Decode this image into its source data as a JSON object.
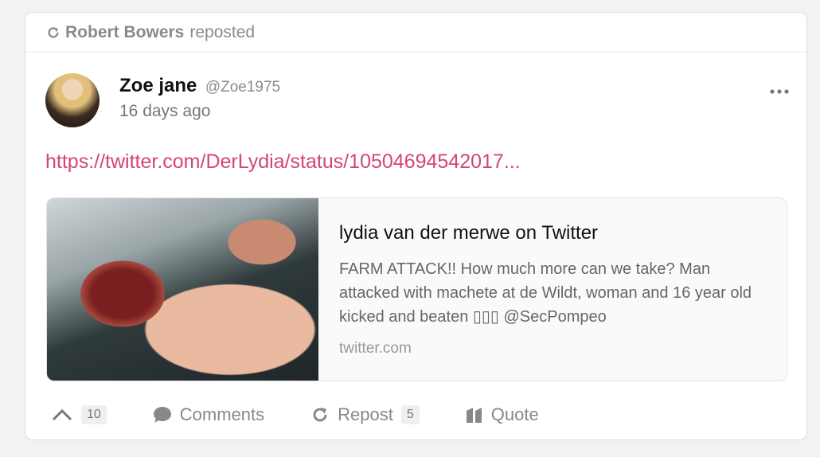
{
  "repost_bar": {
    "icon": "repost-icon",
    "reposter": "Robert Bowers",
    "suffix": "reposted"
  },
  "post": {
    "author_name": "Zoe jane",
    "author_handle": "@Zoe1975",
    "timestamp": "16 days ago",
    "link": "https://twitter.com/DerLydia/status/10504694542017..."
  },
  "link_preview": {
    "title": "lydia van der merwe on Twitter",
    "description": "FARM ATTACK!! How much more can we take? Man attacked with machete at de Wildt, woman and 16 year old kicked and beaten ▯▯▯ @SecPompeo",
    "domain": "twitter.com"
  },
  "actions": {
    "upvote_count": "10",
    "comments_label": "Comments",
    "repost_label": "Repost",
    "repost_count": "5",
    "quote_label": "Quote"
  },
  "colors": {
    "link": "#d4447a",
    "muted": "#8a8a8a"
  }
}
